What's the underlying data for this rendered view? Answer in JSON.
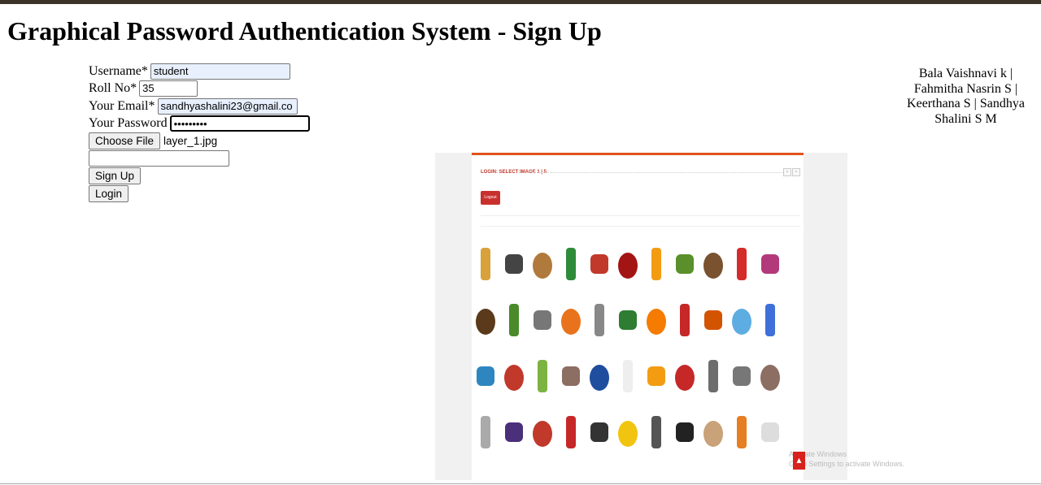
{
  "page": {
    "title": "Graphical Password Authentication System - Sign Up"
  },
  "form": {
    "username_label": "Username*",
    "username_value": "student",
    "rollno_label": "Roll No*",
    "rollno_value": "35",
    "email_label": "Your Email*",
    "email_value": "sandhyashalini23@gmail.co",
    "password_label": "Your Password",
    "password_value": "•••••••••",
    "choose_file_label": "Choose File",
    "file_name": "layer_1.jpg",
    "extra_value": "",
    "signup_label": "Sign Up",
    "login_label": "Login"
  },
  "credits": {
    "line1": "Bala Vaishnavi k |",
    "line2": "Fahmitha Nasrin S |",
    "line3": "Keerthana S | Sandhya",
    "line4": "Shalini S M"
  },
  "preview": {
    "heading": "LOGIN: SELECT IMAGE 1 | 5",
    "logout_label": "Logout",
    "watermark_line1": "Activate Windows",
    "watermark_line2": "Go to Settings to activate Windows.",
    "rows": [
      [
        "pineapple-icon",
        "shoe-icon",
        "basket-icon",
        "bottle-icon",
        "can-icon",
        "cola-bottle-icon",
        "fanta-icon",
        "avocado-icon",
        "bird-icon",
        "strawberry-icon",
        "monitor-icon"
      ],
      [
        "beer-bottle-icon",
        "okra-icon",
        "ball-icon",
        "papaya-icon",
        "wheelbarrow-icon",
        "sprite-can-icon",
        "oranges-icon",
        "watermelon-icon",
        "car-icon",
        "fan-icon",
        "mug-icon"
      ],
      [
        "phone-icon",
        "coke-can-icon",
        "apples-icon",
        "lion-icon",
        "airplane-icon",
        "thread-icon",
        "fanta-bottle-icon",
        "apple-icon",
        "elephant-icon",
        "laptop-icon",
        "dog-icon"
      ],
      [
        "scissors-icon",
        "iron-icon",
        "peppers-icon",
        "motorcycle-icon",
        "speaker-icon",
        "lemon-icon",
        "torch-icon",
        "cpu-icon",
        "onions-icon",
        "pumpkin-icon",
        "goat-icon"
      ]
    ]
  }
}
